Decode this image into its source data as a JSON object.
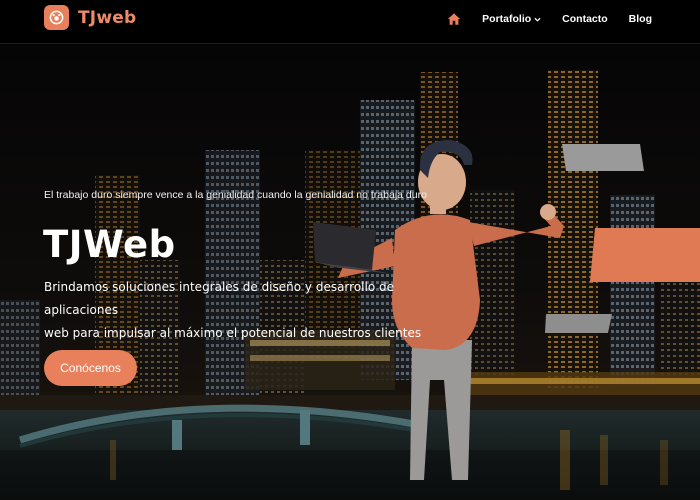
{
  "nav": {
    "brand": "TJweb",
    "items": [
      {
        "label": "Portafolio",
        "has_dropdown": true
      },
      {
        "label": "Contacto",
        "has_dropdown": false
      },
      {
        "label": "Blog",
        "has_dropdown": false
      }
    ],
    "home_icon": "home-icon"
  },
  "hero": {
    "tagline": "El trabajo duro siempre vence a la genialidad cuando la genialidad no trabaja duro",
    "title": "TJWeb",
    "description_line1": "Brindamos soluciones integrales de diseño y desarrollo de aplicaciones",
    "description_line2": "web para impulsar al máximo el potencial de nuestros clientes",
    "cta_label": "Conócenos"
  },
  "colors": {
    "accent": "#e9805c",
    "nav_bg": "#000000",
    "text": "#ffffff"
  }
}
